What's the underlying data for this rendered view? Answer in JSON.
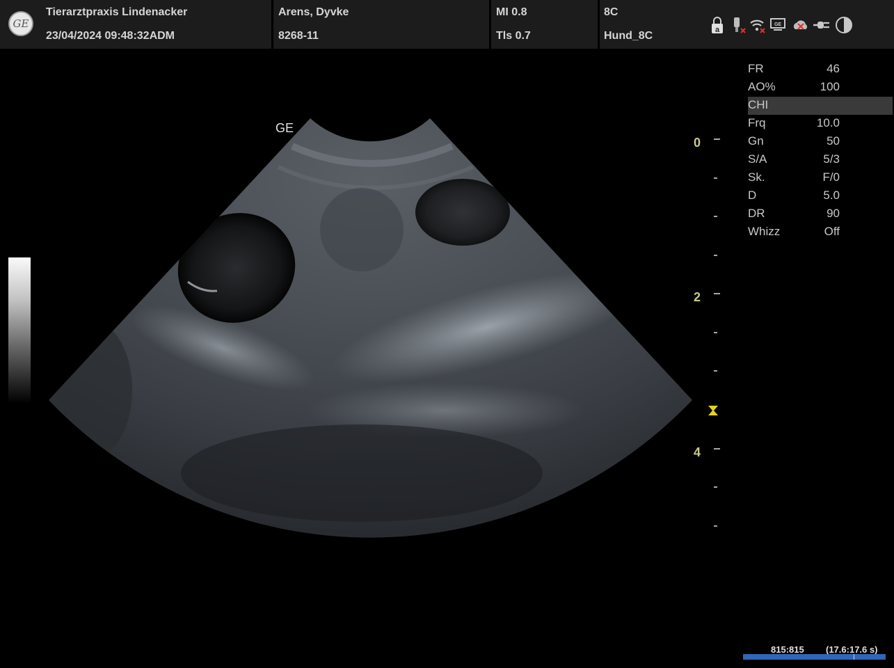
{
  "header": {
    "clinic": "Tierarztpraxis Lindenacker",
    "datetime": "23/04/2024 09:48:32ADM",
    "patient_name": "Arens, Dyvke",
    "patient_id": "8268-11",
    "mi": "MI 0.8",
    "tis": "Tls 0.7",
    "probe": "8C",
    "preset": "Hund_8C",
    "logo_text": "GE"
  },
  "status_icons": [
    "lock-icon",
    "probe-disconnected-icon",
    "wifi-disconnected-icon",
    "monitor-icon",
    "cloud-disconnected-icon",
    "plug-icon",
    "contrast-icon"
  ],
  "image": {
    "corner_label": "GE"
  },
  "depth_scale": {
    "labels": [
      "0",
      "2",
      "4"
    ],
    "unit_marker_color": "#c9c98a"
  },
  "params": [
    {
      "key": "FR",
      "value": "46"
    },
    {
      "key": "AO%",
      "value": "100"
    },
    {
      "key": "CHI",
      "value": "",
      "highlight": true
    },
    {
      "key": "Frq",
      "value": "10.0"
    },
    {
      "key": "Gn",
      "value": "50"
    },
    {
      "key": "S/A",
      "value": "5/3"
    },
    {
      "key": "Sk.",
      "value": "F/0"
    },
    {
      "key": "D",
      "value": "5.0"
    },
    {
      "key": "DR",
      "value": "90"
    },
    {
      "key": "Whizz",
      "value": "Off"
    }
  ],
  "cine": {
    "frames": "815:815",
    "time": "(17.6:17.6 s)",
    "bar_color": "#2f66b8"
  }
}
